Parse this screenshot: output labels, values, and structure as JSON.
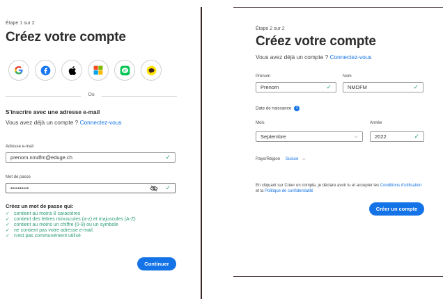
{
  "step1": {
    "step_label": "Étape 1 sur 2",
    "title": "Créez votre compte",
    "social_icons": [
      "google-icon",
      "facebook-icon",
      "apple-icon",
      "microsoft-icon",
      "line-icon",
      "kakaotalk-icon"
    ],
    "or_label": "Ou",
    "email_signup_heading": "S'inscrire avec une adresse e-mail",
    "have_account_text": "Vous avez déjà un compte ?",
    "signin_link": "Connectez-vous",
    "email_label": "Adresse e-mail",
    "email_value": "prenom.nmdfm@eduge.ch",
    "password_label": "Mot de passe",
    "password_value": "••••••••••",
    "password_rules_title": "Créez un mot de passe qui:",
    "password_rules": [
      "contient au moins 8 caractères",
      "contient des lettres minuscules (a-z) et majuscules (A-Z)",
      "contient au moins un chiffre (0-9) ou un symbole",
      "ne contient pas votre adresse e-mail.",
      "n'est pas communément utilisé"
    ],
    "continue_button": "Continuer"
  },
  "step2": {
    "step_label": "Étape 2 sur 2",
    "title": "Créez votre compte",
    "have_account_text": "Vous avez déjà un compte ?",
    "signin_link": "Connectez-vous",
    "first_name_label": "Prénom",
    "first_name_value": "Prenom",
    "last_name_label": "Nom",
    "last_name_value": "NMDFM",
    "dob_label": "Date de naissance",
    "month_label": "Mois",
    "month_value": "Septembre",
    "year_label": "Année",
    "year_value": "2022",
    "country_label": "Pays/Région",
    "country_value": "Suisse",
    "terms_text": "En cliquant sur Créer un compte, je déclare avoir lu et accepter les",
    "terms_link": "Conditions d'utilisation",
    "terms_and": "et la",
    "privacy_link": "Politique de confidentialité",
    "create_button": "Créer un compte"
  },
  "colors": {
    "accent": "#1473e6",
    "success": "#2d9d78",
    "text": "#2c2c2c"
  }
}
